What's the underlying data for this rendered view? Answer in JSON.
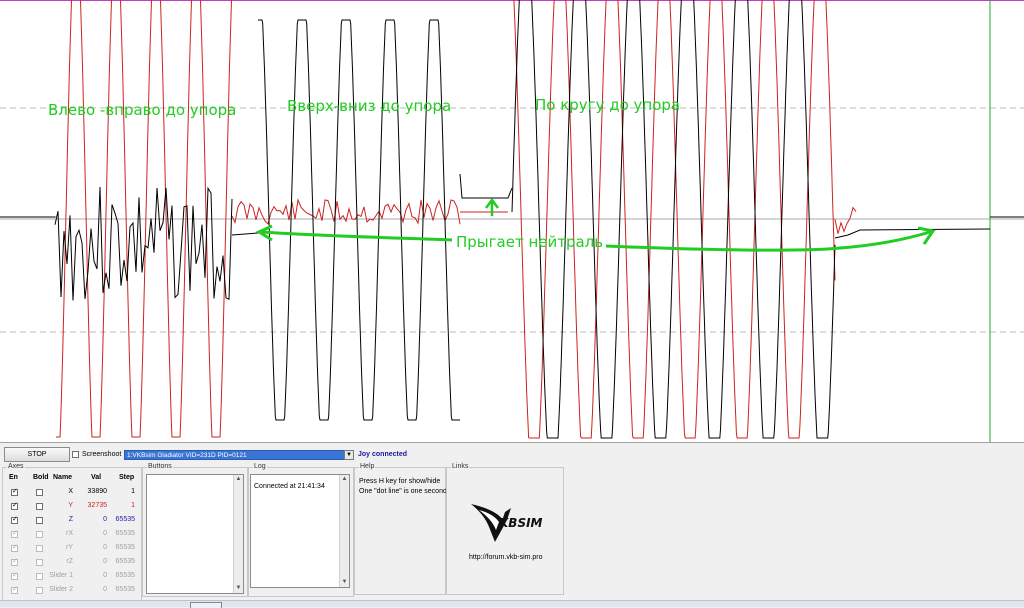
{
  "annotations": {
    "left_right": "Влево -вправо до упора",
    "up_down": "Вверх-вниз до упора",
    "circle": "По кругу до упора",
    "neutral_jump": "Прыгает нейтраль"
  },
  "colors": {
    "annotation": "#22cc22",
    "x_trace": "#000000",
    "y_trace": "#cc2222",
    "z_value": "#2222aa",
    "disabled": "#a0a0a0"
  },
  "toolbar": {
    "stop_label": "STOP",
    "screenshot_label": "Screenshoot",
    "device_selected": "1:VKBsim Gladiator  VID=231D PID=0121",
    "status": "Joy connected"
  },
  "axes": {
    "title": "Axes",
    "headers": {
      "en": "En",
      "bold": "Bold",
      "name": "Name",
      "val": "Val",
      "step": "Step"
    },
    "rows": [
      {
        "name": "X",
        "val": "33890",
        "step": "1",
        "enabled": true,
        "bold": false,
        "active": true,
        "color": "#000000"
      },
      {
        "name": "Y",
        "val": "32735",
        "step": "1",
        "enabled": true,
        "bold": false,
        "active": true,
        "color": "#cc2222"
      },
      {
        "name": "Z",
        "val": "0",
        "step": "65535",
        "enabled": true,
        "bold": false,
        "active": true,
        "color": "#2222aa"
      },
      {
        "name": "rX",
        "val": "0",
        "step": "65535",
        "enabled": true,
        "bold": false,
        "active": false,
        "color": "#a0a0a0"
      },
      {
        "name": "rY",
        "val": "0",
        "step": "65535",
        "enabled": true,
        "bold": false,
        "active": false,
        "color": "#a0a0a0"
      },
      {
        "name": "rZ",
        "val": "0",
        "step": "65535",
        "enabled": true,
        "bold": false,
        "active": false,
        "color": "#a0a0a0"
      },
      {
        "name": "Slider 1",
        "val": "0",
        "step": "65535",
        "enabled": true,
        "bold": false,
        "active": false,
        "color": "#a0a0a0"
      },
      {
        "name": "Slider 2",
        "val": "0",
        "step": "65535",
        "enabled": true,
        "bold": false,
        "active": false,
        "color": "#a0a0a0"
      }
    ]
  },
  "buttons_group": {
    "title": "Buttons"
  },
  "log": {
    "title": "Log",
    "lines": [
      "Connected at 21:41:34"
    ]
  },
  "help": {
    "title": "Help",
    "line1": "Press H key for show/hide",
    "line2": "One \"dot line\" is one second"
  },
  "links": {
    "title": "Links",
    "logo_text": "KBSIM",
    "logo_mark": "V",
    "url": "http://forum.vkb-sim.pro"
  }
}
